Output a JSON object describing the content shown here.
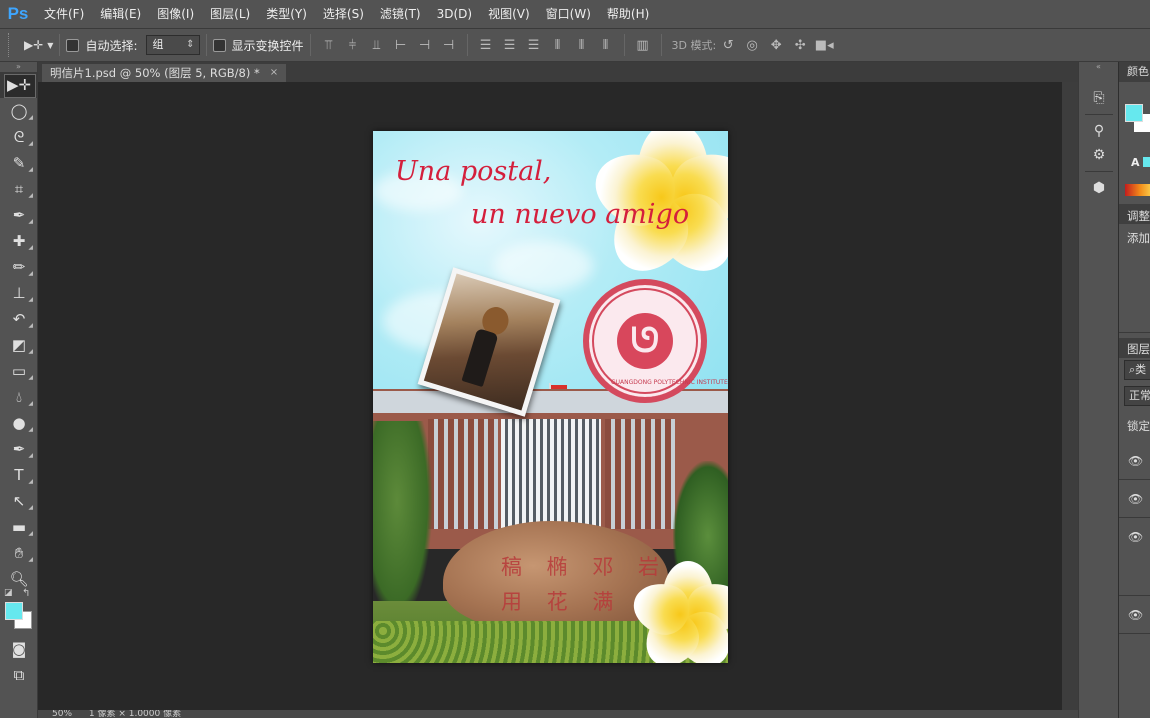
{
  "app": {
    "logo": "Ps"
  },
  "menu": [
    "文件(F)",
    "编辑(E)",
    "图像(I)",
    "图层(L)",
    "类型(Y)",
    "选择(S)",
    "滤镜(T)",
    "3D(D)",
    "视图(V)",
    "窗口(W)",
    "帮助(H)"
  ],
  "options": {
    "tool_icon": "move-tool-icon",
    "auto_select_label": "自动选择:",
    "auto_select_value": "组",
    "show_transform_label": "显示变换控件",
    "mode3d_label": "3D 模式:"
  },
  "document": {
    "tab_title": "明信片1.psd @ 50% (图层 5, RGB/8) *",
    "close": "×"
  },
  "status": {
    "zoom": "50%",
    "info": "1 像素 × 1.0000 像素"
  },
  "postcard": {
    "line1": "Una postal,",
    "line2": "un nuevo amigo",
    "seal_ring": "GUANGDONG POLYTECHNIC INSTITUTE",
    "rock_line1": "稿 椭 邓 岩",
    "rock_line2": "用 花 满 院"
  },
  "colors": {
    "foreground": "#66e8ee",
    "background": "#ffffff",
    "title_text": "#d41f3c"
  },
  "panels": {
    "color_tab": "颜色",
    "adjust_tab": "调整",
    "adjust_add": "添加",
    "layers_tab": "图层",
    "search_placeholder": "类",
    "blend_mode": "正常",
    "lock_label": "锁定"
  }
}
